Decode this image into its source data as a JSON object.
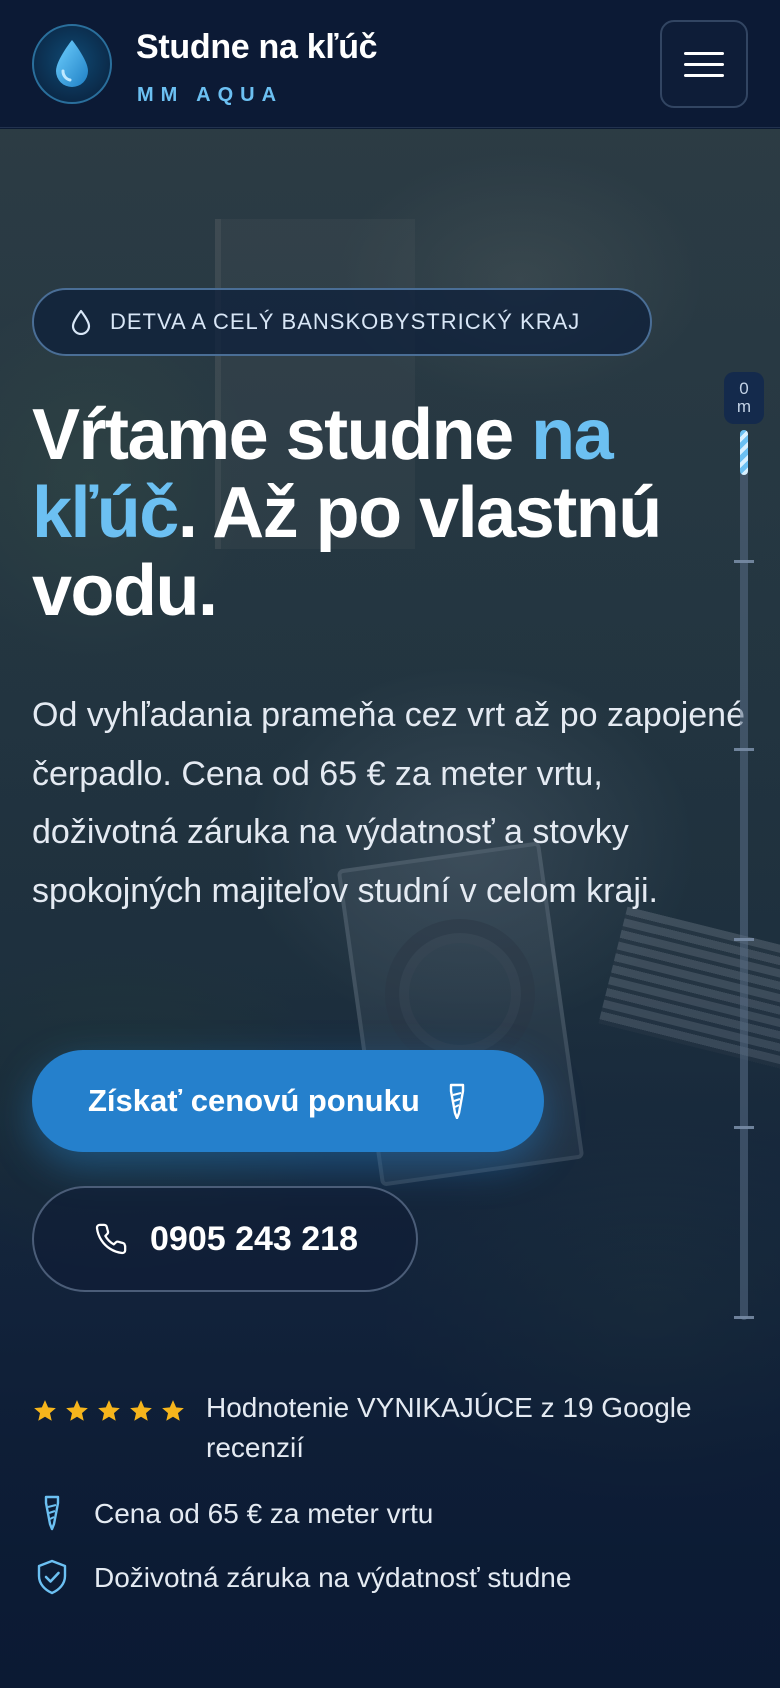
{
  "header": {
    "brand_name": "Studne na kľúč",
    "brand_sub": "MM AQUA",
    "logo_icon": "water-drop-icon",
    "menu_icon": "hamburger-menu-icon"
  },
  "hero": {
    "region_badge": "DETVA A CELÝ BANSKOBYSTRICKÝ KRAJ",
    "headline": {
      "part1": "Vŕtame studne ",
      "accent1": "na",
      "accent2": "kľúč",
      "part2": ". Až po vlastnú vodu."
    },
    "lead": "Od vyhľadania prameňa cez vrt až po zapojené čerpadlo. Cena od 65 € za meter vrtu, doživotná záruka na výdatnosť a stovky spokojných majiteľov studní v celom kraji.",
    "cta_primary": "Získať cenovú ponuku",
    "cta_phone": "0905 243 218"
  },
  "depth_gauge": {
    "value": "0",
    "unit": "m",
    "progress": 0.05
  },
  "trust": {
    "rating_stars": 5,
    "rating_text": "Hodnotenie VYNIKAJÚCE z 19 Google recenzií",
    "price_text": "Cena od 65 € za meter vrtu",
    "warranty_text": "Doživotná záruka na výdatnosť studne"
  },
  "colors": {
    "accent": "#6cc0f2",
    "primary_button": "#2580cc",
    "star": "#f6b51c",
    "background": "#0b1a33"
  }
}
